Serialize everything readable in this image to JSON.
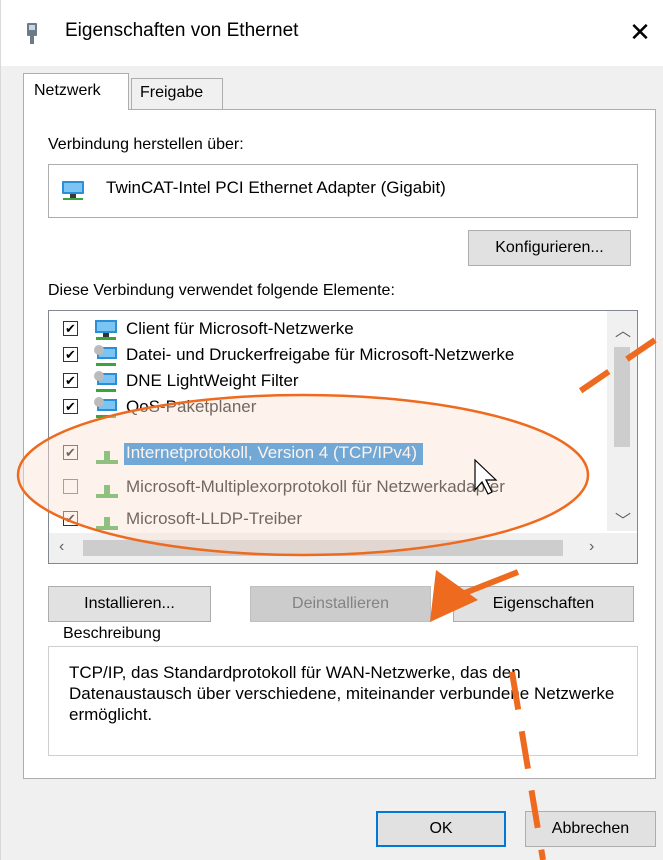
{
  "window": {
    "title": "Eigenschaften von Ethernet",
    "close_glyph": "✕"
  },
  "tabs": [
    {
      "label": "Netzwerk",
      "active": true
    },
    {
      "label": "Freigabe",
      "active": false
    }
  ],
  "connection": {
    "label": "Verbindung herstellen über:",
    "adapter_name": "TwinCAT-Intel PCI Ethernet Adapter (Gigabit)",
    "adapter_icon": "network-adapter-icon",
    "configure_button": "Konfigurieren..."
  },
  "elements": {
    "label": "Diese Verbindung verwendet folgende Elemente:",
    "items": [
      {
        "label": "Client für Microsoft-Netzwerke",
        "checked": true,
        "icon": "network-client-icon",
        "selected": false
      },
      {
        "label": "Datei- und Druckerfreigabe für Microsoft-Netzwerke",
        "checked": true,
        "icon": "network-service-icon",
        "selected": false
      },
      {
        "label": "DNE LightWeight Filter",
        "checked": true,
        "icon": "network-service-icon",
        "selected": false
      },
      {
        "label": "QoS-Paketplaner",
        "checked": true,
        "icon": "network-service-icon",
        "selected": false
      },
      {
        "label": "Internetprotokoll, Version 4 (TCP/IPv4)",
        "checked": true,
        "icon": "protocol-icon",
        "selected": true
      },
      {
        "label": "Microsoft-Multiplexorprotokoll für Netzwerkadapter",
        "checked": false,
        "icon": "protocol-icon",
        "selected": false
      },
      {
        "label": "Microsoft-LLDP-Treiber",
        "checked": true,
        "icon": "protocol-icon",
        "selected": false
      }
    ],
    "install_button": "Installieren...",
    "uninstall_button": "Deinstallieren",
    "properties_button": "Eigenschaften"
  },
  "description": {
    "legend": "Beschreibung",
    "text": "TCP/IP, das Standardprotokoll für WAN-Netzwerke, das den Datenaustausch über verschiedene, miteinander verbundene Netzwerke ermöglicht."
  },
  "footer": {
    "ok_button": "OK",
    "cancel_button": "Abbrechen"
  },
  "colors": {
    "accent": "#0078d7",
    "annotation": "#ee6a1e",
    "highlight_fill": "#fbe3d4"
  }
}
